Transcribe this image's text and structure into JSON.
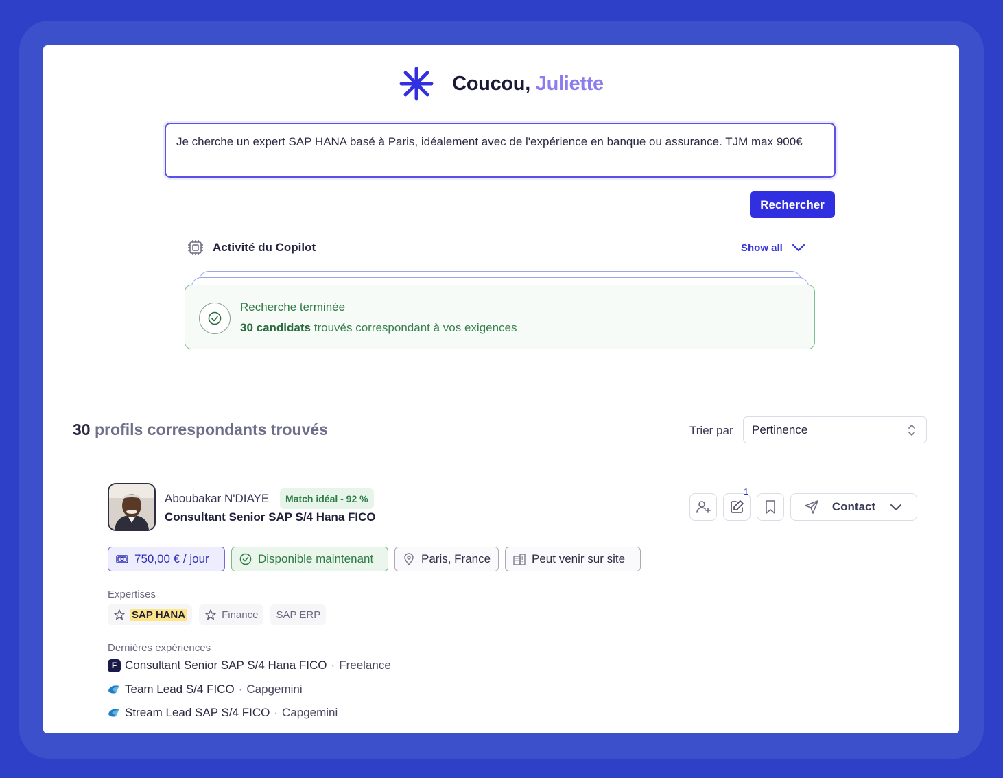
{
  "greeting": {
    "prefix": "Coucou,",
    "name": "Juliette"
  },
  "prompt": {
    "text": "Je cherche un expert SAP HANA basé à Paris, idéalement avec de l'expérience en banque ou assurance. TJM max 900€"
  },
  "search_button": "Rechercher",
  "copilot": {
    "title": "Activité du Copilot",
    "show_all": "Show all",
    "result_title": "Recherche terminée",
    "result_count": "30 candidats",
    "result_rest": "trouvés correspondant à vos exigences"
  },
  "results": {
    "count": "30",
    "title": "profils correspondants trouvés",
    "sort_label": "Trier par",
    "sort_value": "Pertinence"
  },
  "candidate": {
    "name": "Aboubakar N'DIAYE",
    "match": "Match idéal - 92 %",
    "title": "Consultant Senior SAP S/4 Hana FICO",
    "notes_count": "1",
    "contact_label": "Contact",
    "tags": {
      "rate": "750,00 € / jour",
      "availability": "Disponible maintenant",
      "location": "Paris, France",
      "onsite": "Peut venir sur site"
    },
    "expertises_label": "Expertises",
    "expertises": [
      "SAP HANA",
      "Finance",
      "SAP ERP"
    ],
    "experiences_label": "Dernières expériences",
    "experiences": [
      {
        "title": "Consultant Senior SAP S/4 Hana FICO",
        "company": "Freelance",
        "logo_letter": "F"
      },
      {
        "title": "Team Lead S/4 FICO",
        "company": "Capgemini"
      },
      {
        "title": "Stream Lead SAP S/4 FICO",
        "company": "Capgemini"
      }
    ],
    "separator": "·"
  },
  "colors": {
    "background": "#2e40c8",
    "accent": "#3030e0",
    "name_accent": "#8b7cf0",
    "success": "#2e7d47",
    "highlight": "#fde58a"
  }
}
